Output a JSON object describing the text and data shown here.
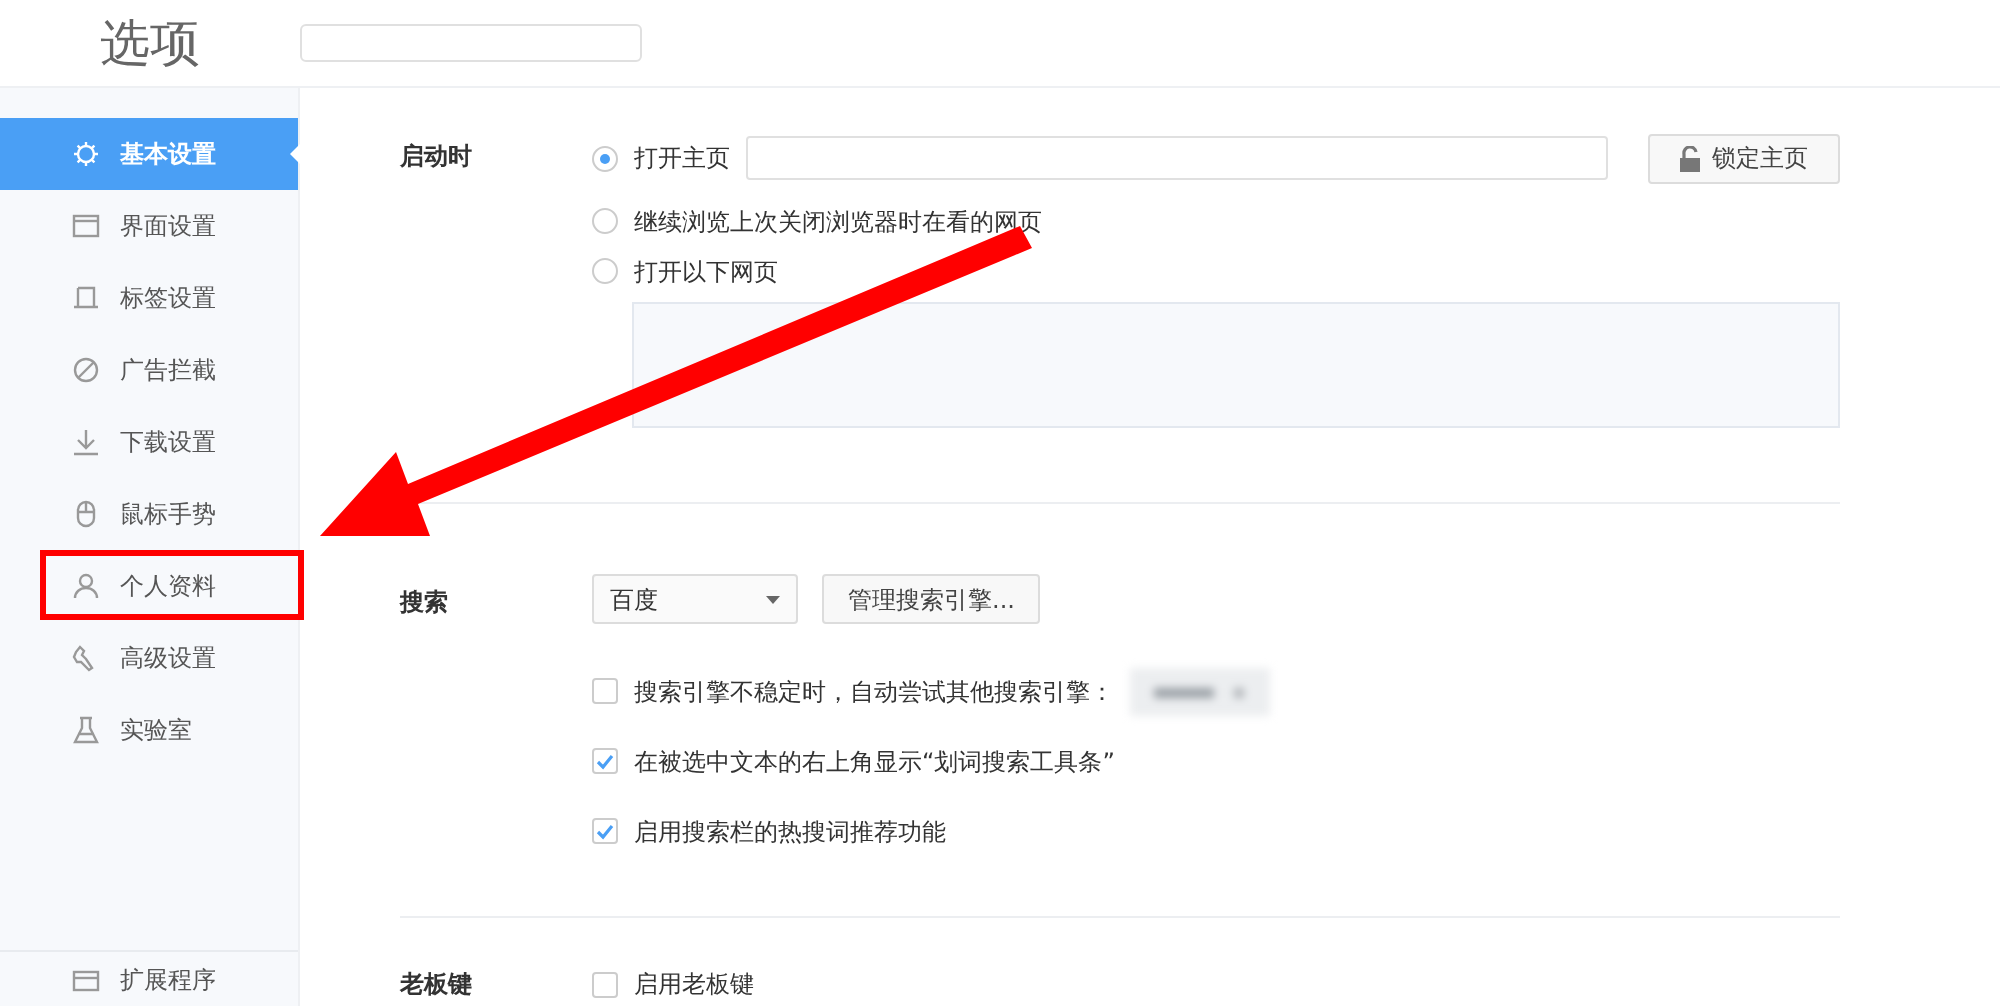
{
  "window": {
    "title": "选项"
  },
  "sidebar": {
    "items": [
      {
        "label": "基本设置",
        "selected": true
      },
      {
        "label": "界面设置",
        "selected": false
      },
      {
        "label": "标签设置",
        "selected": false
      },
      {
        "label": "广告拦截",
        "selected": false
      },
      {
        "label": "下载设置",
        "selected": false
      },
      {
        "label": "鼠标手势",
        "selected": false
      },
      {
        "label": "个人资料",
        "selected": false
      },
      {
        "label": "高级设置",
        "selected": false
      },
      {
        "label": "实验室",
        "selected": false
      }
    ],
    "footer_item": {
      "label": "扩展程序"
    }
  },
  "startup": {
    "label": "启动时",
    "options": [
      {
        "label": "打开主页",
        "selected": true
      },
      {
        "label": "继续浏览上次关闭浏览器时在看的网页",
        "selected": false
      },
      {
        "label": "打开以下网页",
        "selected": false
      }
    ],
    "lock_button": "锁定主页"
  },
  "search": {
    "label": "搜索",
    "engine": "百度",
    "manage_button": "管理搜索引擎...",
    "options": [
      {
        "label": "搜索引擎不稳定时，自动尝试其他搜索引擎：",
        "checked": false
      },
      {
        "label": "在被选中文本的右上角显示“划词搜索工具条”",
        "checked": true
      },
      {
        "label": "启用搜索栏的热搜词推荐功能",
        "checked": true
      }
    ]
  },
  "boss_key": {
    "label": "老板键",
    "option": {
      "label": "启用老板键",
      "checked": false
    }
  }
}
